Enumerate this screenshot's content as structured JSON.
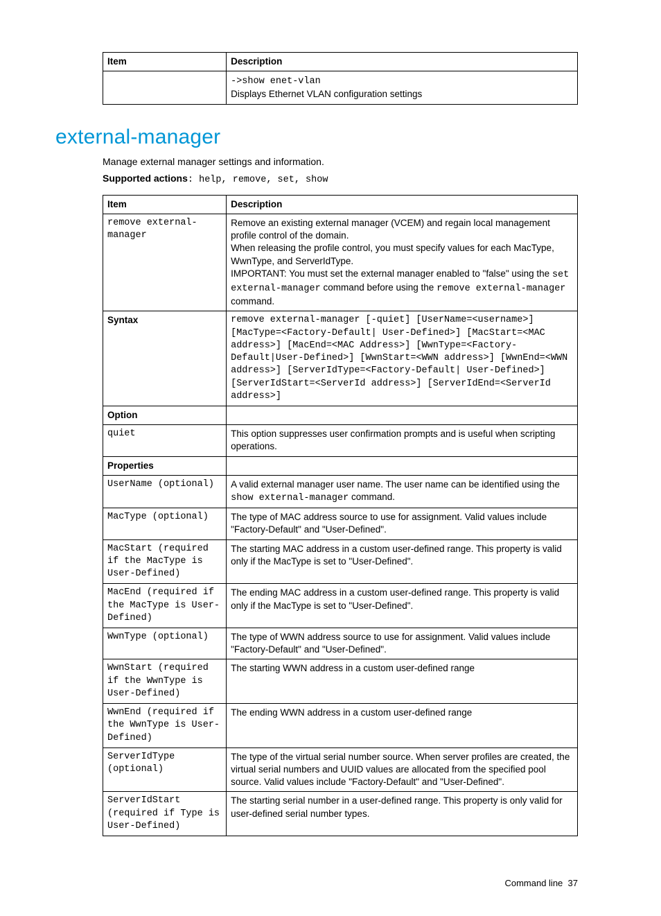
{
  "table1": {
    "headers": {
      "item": "Item",
      "desc": "Description"
    },
    "row": {
      "code": "->show enet-vlan",
      "text": "Displays Ethernet VLAN configuration settings"
    }
  },
  "section": {
    "title": "external-manager",
    "intro": "Manage external manager settings and information.",
    "supported_label": "Supported actions",
    "supported_actions": ": help, remove, set, show"
  },
  "table2": {
    "headers": {
      "item": "Item",
      "desc": "Description"
    },
    "rows": {
      "remove_cmd": "remove external-manager",
      "remove_desc_1": "Remove an existing external manager (VCEM) and regain local management profile control of the domain.",
      "remove_desc_2": "When releasing the profile control, you must specify values for each MacType, WwnType, and ServerIdType.",
      "remove_desc_3a": "IMPORTANT: You must set the external manager enabled to \"false\" using the ",
      "remove_desc_3b": "set external-manager",
      "remove_desc_3c": " command before using the ",
      "remove_desc_3d": "remove external-manager",
      "remove_desc_3e": " command.",
      "syntax_label": "Syntax",
      "syntax_code": "remove external-manager [-quiet] [UserName=<username>] [MacType=<Factory-Default| User-Defined>] [MacStart=<MAC address>] [MacEnd=<MAC Address>] [WwnType=<Factory-Default|User-Defined>] [WwnStart=<WWN address>] [WwnEnd=<WWN address>] [ServerIdType=<Factory-Default| User-Defined>] [ServerIdStart=<ServerId address>] [ServerIdEnd=<ServerId address>]",
      "option_label": "Option",
      "quiet_name": "quiet",
      "quiet_desc": "This option suppresses user confirmation prompts and is useful when scripting operations.",
      "properties_label": "Properties",
      "username_name": "UserName (optional)",
      "username_desc_a": "A valid external manager user name. The user name can be identified using the ",
      "username_desc_b": "show external-manager",
      "username_desc_c": " command.",
      "mactype_name": "MacType (optional)",
      "mactype_desc": "The type of MAC address source to use for assignment. Valid values include \"Factory-Default\" and \"User-Defined\".",
      "macstart_name": "MacStart (required if the MacType is User-Defined)",
      "macstart_desc": "The starting MAC address in a custom user-defined range. This property is valid only if the MacType is set to \"User-Defined\".",
      "macend_name": "MacEnd (required if the MacType is User-Defined)",
      "macend_desc": "The ending MAC address in a custom user-defined range. This property is valid only if the MacType is set to \"User-Defined\".",
      "wwntype_name": "WwnType (optional)",
      "wwntype_desc": "The type of WWN address source to use for assignment. Valid values include \"Factory-Default\" and \"User-Defined\".",
      "wwnstart_name": "WwnStart (required if the WwnType is User-Defined)",
      "wwnstart_desc": "The starting WWN address in a custom user-defined range",
      "wwnend_name": "WwnEnd (required if the WwnType is User-Defined)",
      "wwnend_desc": "The ending WWN address in a custom user-defined range",
      "serveridtype_name": "ServerIdType (optional)",
      "serveridtype_desc": "The type of the virtual serial number source. When server profiles are created, the virtual serial numbers and UUID values are allocated from the specified pool source. Valid values include \"Factory-Default\" and \"User-Defined\".",
      "serveridstart_name": "ServerIdStart (required if Type is User-Defined)",
      "serveridstart_desc": "The starting serial number in a user-defined range. This property is only valid for user-defined serial number types."
    }
  },
  "footer": {
    "text": "Command line",
    "page": "37"
  }
}
